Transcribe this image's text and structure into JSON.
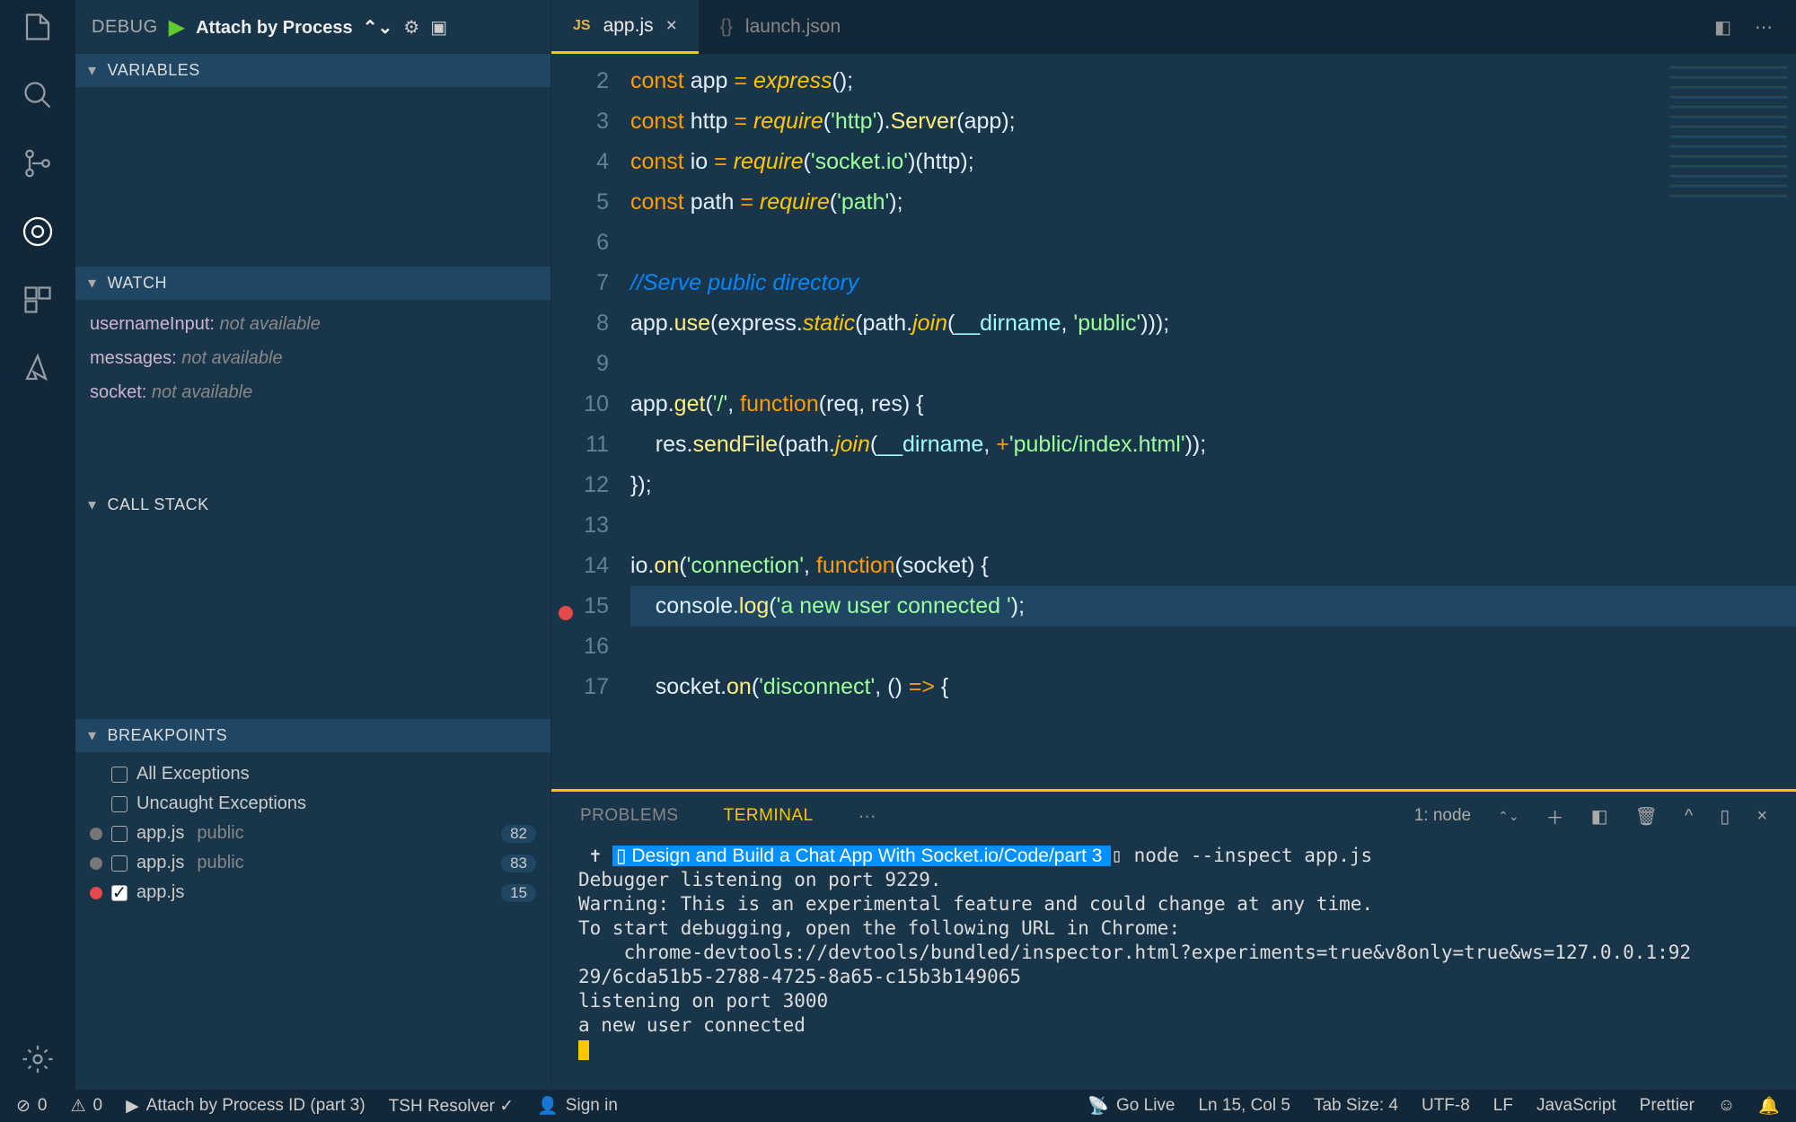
{
  "debug": {
    "title": "DEBUG",
    "config": "Attach by Process",
    "sections": {
      "variables": "VARIABLES",
      "watch": "WATCH",
      "callstack": "CALL STACK",
      "breakpoints": "BREAKPOINTS"
    },
    "watch_items": [
      {
        "name": "usernameInput:",
        "value": "not available"
      },
      {
        "name": "messages:",
        "value": "not available"
      },
      {
        "name": "socket:",
        "value": "not available"
      }
    ],
    "breakpoints": [
      {
        "kind": "builtin",
        "checked": false,
        "label": "All Exceptions"
      },
      {
        "kind": "builtin",
        "checked": false,
        "label": "Uncaught Exceptions"
      },
      {
        "kind": "bp",
        "dot": "grey",
        "checked": false,
        "file": "app.js",
        "tag": "public",
        "line": "82"
      },
      {
        "kind": "bp",
        "dot": "grey",
        "checked": false,
        "file": "app.js",
        "tag": "public",
        "line": "83"
      },
      {
        "kind": "bp",
        "dot": "red",
        "checked": true,
        "file": "app.js",
        "tag": "",
        "line": "15"
      }
    ]
  },
  "tabs": {
    "active": {
      "icon": "JS",
      "label": "app.js"
    },
    "other": {
      "icon": "{}",
      "label": "launch.json"
    }
  },
  "editor": {
    "first_line": 2,
    "breakpoint_line": 15,
    "highlight_line": 15,
    "lines_html": [
      "<span class='tok-kw'>const</span> <span class='tok-id'>app</span> <span class='tok-op'>=</span> <span class='tok-fn'>express</span><span class='tok-par'>(</span><span class='tok-par'>)</span><span class='tok-pun'>;</span>",
      "<span class='tok-kw'>const</span> <span class='tok-id'>http</span> <span class='tok-op'>=</span> <span class='tok-fn'>require</span><span class='tok-par'>(</span><span class='tok-str'>'http'</span><span class='tok-par'>)</span><span class='tok-pun'>.</span><span class='tok-call'>Server</span><span class='tok-par'>(</span><span class='tok-id'>app</span><span class='tok-par'>)</span><span class='tok-pun'>;</span>",
      "<span class='tok-kw'>const</span> <span class='tok-id'>io</span> <span class='tok-op'>=</span> <span class='tok-fn'>require</span><span class='tok-par'>(</span><span class='tok-str'>'socket.io'</span><span class='tok-par'>)(</span><span class='tok-id'>http</span><span class='tok-par'>)</span><span class='tok-pun'>;</span>",
      "<span class='tok-kw'>const</span> <span class='tok-id'>path</span> <span class='tok-op'>=</span> <span class='tok-fn'>require</span><span class='tok-par'>(</span><span class='tok-str'>'path'</span><span class='tok-par'>)</span><span class='tok-pun'>;</span>",
      "",
      "<span class='tok-cm'>//Serve public directory</span>",
      "<span class='tok-id'>app</span><span class='tok-pun'>.</span><span class='tok-call'>use</span><span class='tok-par'>(</span><span class='tok-id'>express</span><span class='tok-pun'>.</span><span class='tok-fn'>static</span><span class='tok-par'>(</span><span class='tok-id'>path</span><span class='tok-pun'>.</span><span class='tok-fn'>join</span><span class='tok-par'>(</span><span class='tok-prop'>__dirname</span><span class='tok-pun'>,</span> <span class='tok-str'>'public'</span><span class='tok-par'>)))</span><span class='tok-pun'>;</span>",
      "",
      "<span class='tok-id'>app</span><span class='tok-pun'>.</span><span class='tok-call'>get</span><span class='tok-par'>(</span><span class='tok-str'>'/'</span><span class='tok-pun'>,</span> <span class='tok-kw'>function</span><span class='tok-par'>(</span><span class='tok-id'>req</span><span class='tok-pun'>,</span> <span class='tok-id'>res</span><span class='tok-par'>)</span> <span class='tok-par'>{</span>",
      "    <span class='tok-id'>res</span><span class='tok-pun'>.</span><span class='tok-call'>sendFile</span><span class='tok-par'>(</span><span class='tok-id'>path</span><span class='tok-pun'>.</span><span class='tok-fn'>join</span><span class='tok-par'>(</span><span class='tok-prop'>__dirname</span><span class='tok-pun'>,</span> <span class='tok-op'>+</span><span class='tok-str'>'public/index.html'</span><span class='tok-par'>))</span><span class='tok-pun'>;</span>",
      "<span class='tok-par'>})</span><span class='tok-pun'>;</span>",
      "",
      "<span class='tok-id'>io</span><span class='tok-pun'>.</span><span class='tok-call'>on</span><span class='tok-par'>(</span><span class='tok-str'>'connection'</span><span class='tok-pun'>,</span> <span class='tok-kw'>function</span><span class='tok-par'>(</span><span class='tok-id'>socket</span><span class='tok-par'>)</span> <span class='tok-par'>{</span>",
      "    <span class='tok-id'>console</span><span class='tok-pun'>.</span><span class='tok-call'>log</span><span class='tok-par'>(</span><span class='tok-str'>'a new user connected '</span><span class='tok-par'>)</span><span class='tok-pun'>;</span>",
      "",
      "    <span class='tok-id'>socket</span><span class='tok-pun'>.</span><span class='tok-call'>on</span><span class='tok-par'>(</span><span class='tok-str'>'disconnect'</span><span class='tok-pun'>,</span> <span class='tok-par'>()</span> <span class='tok-op'>=></span> <span class='tok-par'>{</span>"
    ]
  },
  "panel": {
    "tabs": {
      "problems": "PROBLEMS",
      "terminal": "TERMINAL"
    },
    "term_selector": "1: node",
    "term_prompt_path": "Design and Build a Chat App With Socket.io/Code/part 3",
    "term_cmd": "node --inspect app.js",
    "term_lines": [
      "Debugger listening on port 9229.",
      "Warning: This is an experimental feature and could change at any time.",
      "To start debugging, open the following URL in Chrome:",
      "    chrome-devtools://devtools/bundled/inspector.html?experiments=true&v8only=true&ws=127.0.0.1:92",
      "29/6cda51b5-2788-4725-8a65-c15b3b149065",
      "listening on port 3000",
      "a new user connected"
    ]
  },
  "status": {
    "errors": "0",
    "warnings": "0",
    "launch": "Attach by Process ID (part 3)",
    "tsh": "TSH Resolver ✓",
    "signin": "Sign in",
    "golive": "Go Live",
    "lncol": "Ln 15, Col 5",
    "tabsize": "Tab Size: 4",
    "enc": "UTF-8",
    "eol": "LF",
    "lang": "JavaScript",
    "prettier": "Prettier"
  }
}
